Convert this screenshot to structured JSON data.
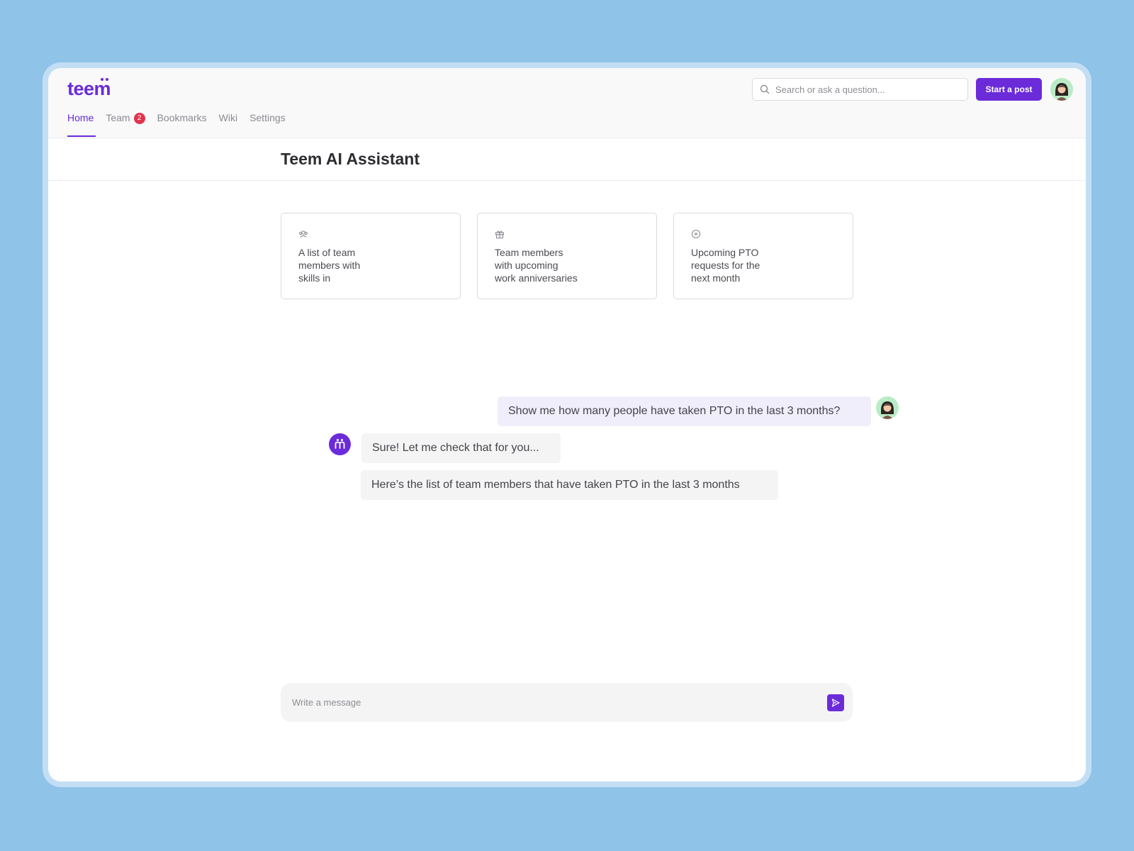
{
  "app": {
    "logo": "teem"
  },
  "nav": {
    "items": [
      {
        "label": "Home",
        "active": true
      },
      {
        "label": "Team",
        "badge": "2"
      },
      {
        "label": "Bookmarks"
      },
      {
        "label": "Wiki"
      },
      {
        "label": "Settings"
      }
    ]
  },
  "header": {
    "search_placeholder": "Search or ask a question...",
    "start_post_label": "Start a post",
    "search_icon": "search-icon"
  },
  "page": {
    "title": "Teem AI Assistant"
  },
  "suggestions": [
    {
      "icon": "people-icon",
      "text": "A list of team members with skills in"
    },
    {
      "icon": "gift-icon",
      "text": "Team members with upcoming work anniversaries"
    },
    {
      "icon": "plus-circle-icon",
      "text": "Upcoming PTO requests for the next month"
    }
  ],
  "conversation": {
    "user_message": "Show me how many people have taken PTO in the last 3 months?",
    "bot_messages": [
      "Sure! Let me check that for you...",
      "Here’s the list of team members that have taken PTO in the last 3 months"
    ]
  },
  "composer": {
    "placeholder": "Write a message",
    "send_icon": "send-icon"
  },
  "colors": {
    "accent": "#6b2bd9",
    "badge": "#e2334d",
    "background": "#8fc3e8"
  }
}
